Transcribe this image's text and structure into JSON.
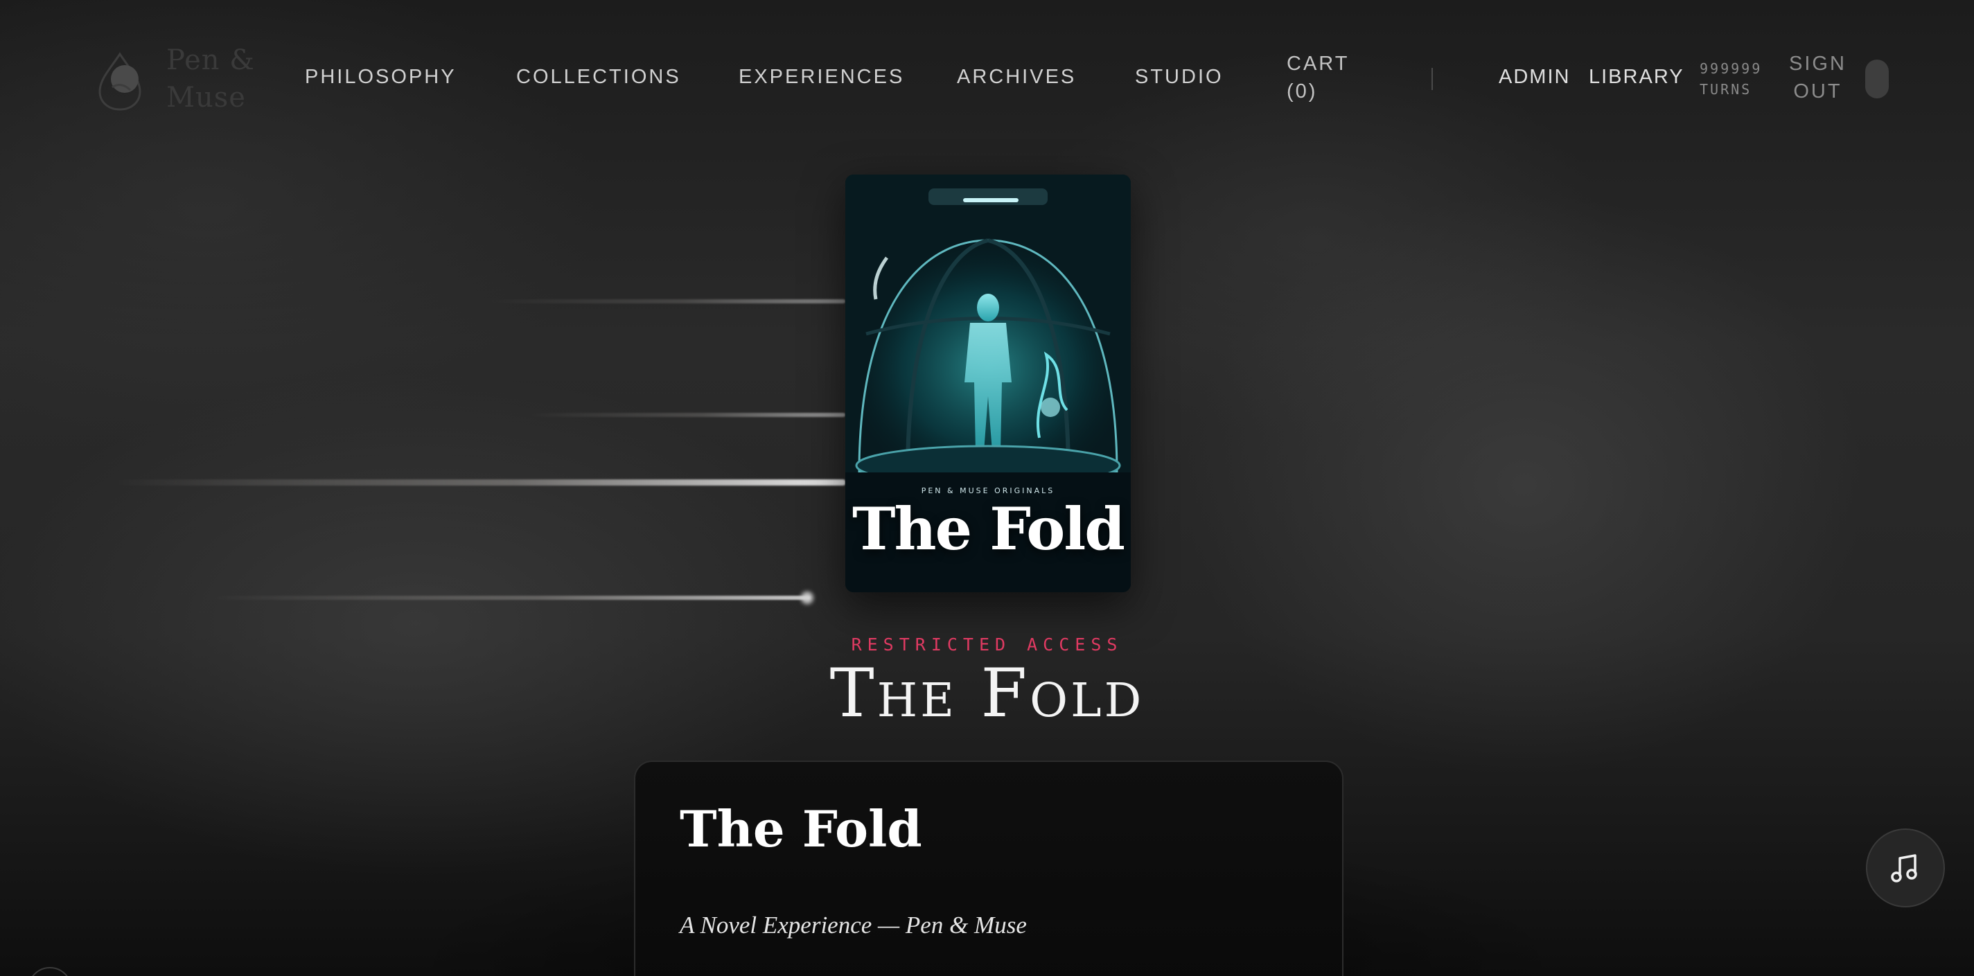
{
  "brand": {
    "name_line1": "Pen &",
    "name_line2": "Muse"
  },
  "nav": {
    "items": [
      "PHILOSOPHY",
      "COLLECTIONS",
      "EXPERIENCES",
      "ARCHIVES",
      "STUDIO"
    ],
    "cart_label": "CART",
    "cart_count": "(0)"
  },
  "account": {
    "admin_label": "ADMIN",
    "library_label": "LIBRARY",
    "turns_value": "999999",
    "turns_label": "TURNS",
    "signout_line1": "SIGN",
    "signout_line2": "OUT"
  },
  "cover": {
    "series": "PEN & MUSE ORIGINALS",
    "title": "The Fold"
  },
  "hero": {
    "eyebrow": "RESTRICTED ACCESS",
    "title": "The Fold"
  },
  "card": {
    "title": "The Fold",
    "subtitle": "A Novel Experience — Pen & Muse"
  },
  "colors": {
    "accent": "#e03a62",
    "background": "#1e1e1e",
    "card": "#0c0c0c"
  },
  "icons": {
    "logo": "ink-drop-icon",
    "music": "music-note-icon"
  }
}
